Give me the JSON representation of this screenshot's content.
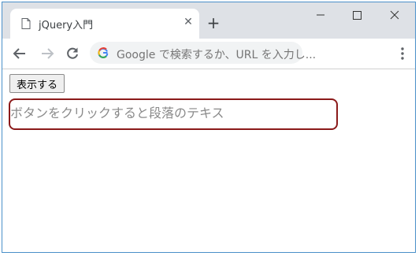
{
  "browser": {
    "tab": {
      "title": "jQuery入門",
      "close_glyph": "✕"
    },
    "new_tab_glyph": "+",
    "omnibox": {
      "placeholder": "Google で検索するか、URL を入力し..."
    }
  },
  "page": {
    "show_button_label": "表示する",
    "paragraph_text": "ボタンをクリックすると段落のテキス"
  },
  "colors": {
    "titlebar": "#dee1e6",
    "paragraph_border": "#8b1a1a",
    "window_border": "#4a90c9"
  }
}
